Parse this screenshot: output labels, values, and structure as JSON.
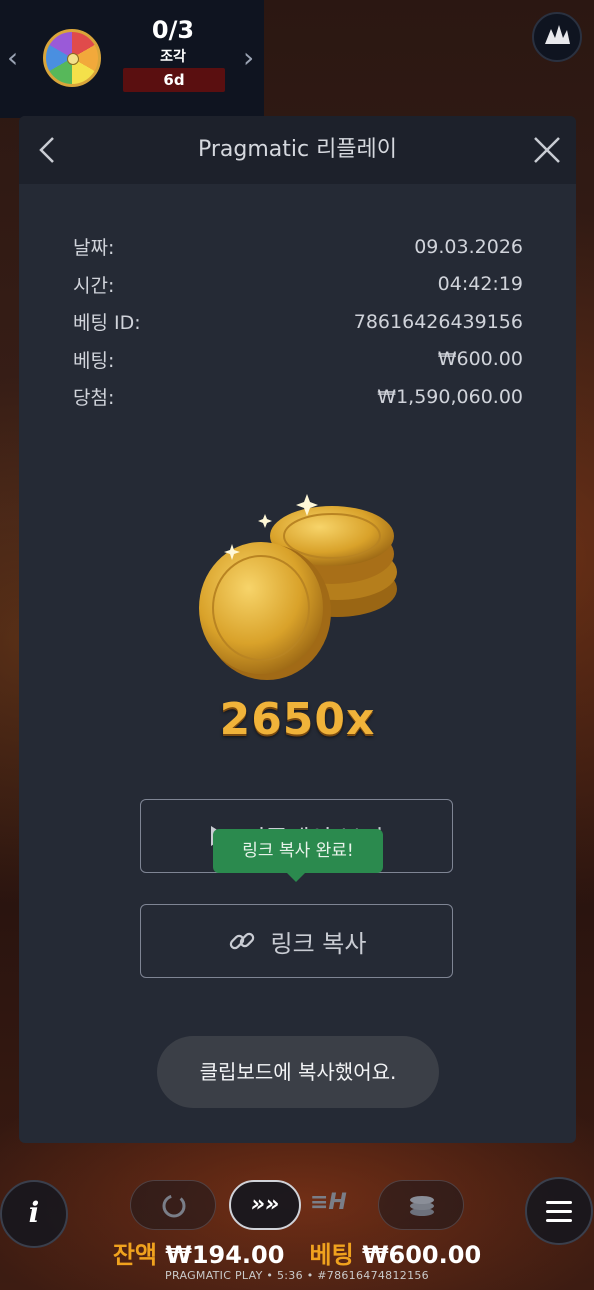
{
  "promo": {
    "count": "0/3",
    "label": "조각",
    "days": "6d"
  },
  "modal": {
    "title": "Pragmatic 리플레이",
    "rows": [
      {
        "label": "날짜:",
        "value": "09.03.2026"
      },
      {
        "label": "시간:",
        "value": "04:42:19"
      },
      {
        "label": "베팅 ID:",
        "value": "78616426439156"
      },
      {
        "label": "베팅:",
        "value": "₩600.00"
      },
      {
        "label": "당첨:",
        "value": "₩1,590,060.00"
      }
    ],
    "multiplier": "2650x",
    "play_button_label": "리플레이 보기",
    "copy_button_label": "링크 복사",
    "tooltip": "링크 복사 완료!"
  },
  "toast": "클립보드에 복사했어요.",
  "bottom": {
    "turbo_label": "»»",
    "quick_label": "≡H",
    "balance_label": "잔액",
    "balance_value": "₩194.00",
    "bet_label": "베팅",
    "bet_value": "₩600.00",
    "footer": "PRAGMATIC PLAY • 5:36 • #78616474812156"
  },
  "colors": {
    "modal_bg": "#252a35",
    "tooltip_bg": "#2b8a4e",
    "accent_gold": "#f0a21e"
  },
  "icons": [
    "chevron-left-icon",
    "chevron-right-icon",
    "wheel-icon",
    "pragmatic-logo-icon",
    "back-icon",
    "close-icon",
    "gold-coins-icon",
    "play-icon",
    "link-icon",
    "info-icon",
    "autoplay-icon",
    "menu-icon",
    "coin-stack-icon"
  ]
}
